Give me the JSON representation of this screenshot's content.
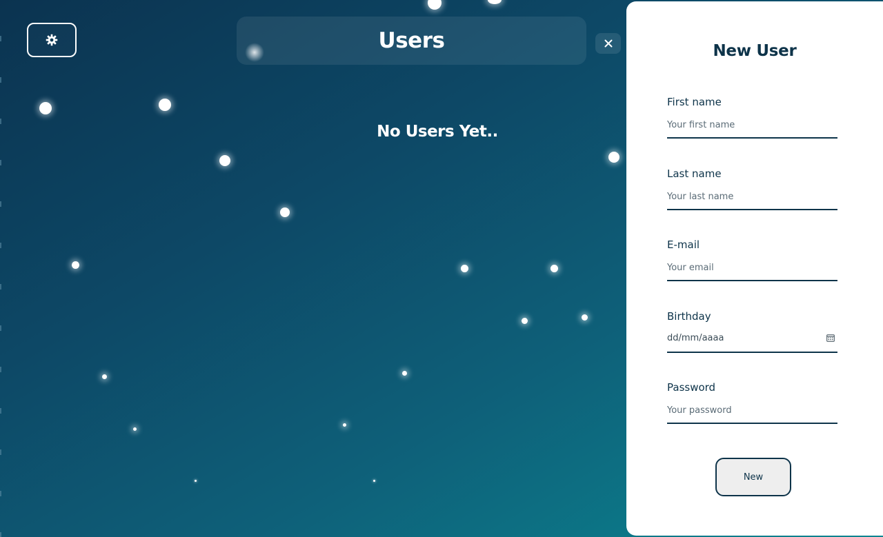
{
  "header": {
    "title": "Users",
    "settings_icon": "gear-icon",
    "close_icon": "close-icon"
  },
  "main": {
    "empty_message": "No Users Yet.."
  },
  "form": {
    "title": "New User",
    "fields": [
      {
        "label": "First name",
        "placeholder": "Your first name"
      },
      {
        "label": "Last name",
        "placeholder": "Your last name"
      },
      {
        "label": "E-mail",
        "placeholder": "Your email"
      },
      {
        "label": "Birthday",
        "placeholder": "dd/mm/aaaa"
      },
      {
        "label": "Password",
        "placeholder": "Your password"
      }
    ],
    "submit_label": "New"
  },
  "colors": {
    "accent": "#0d3349",
    "background_start": "#0b3350",
    "background_end": "#0b8590",
    "panel": "#ffffff",
    "button": "#eeeeee"
  }
}
